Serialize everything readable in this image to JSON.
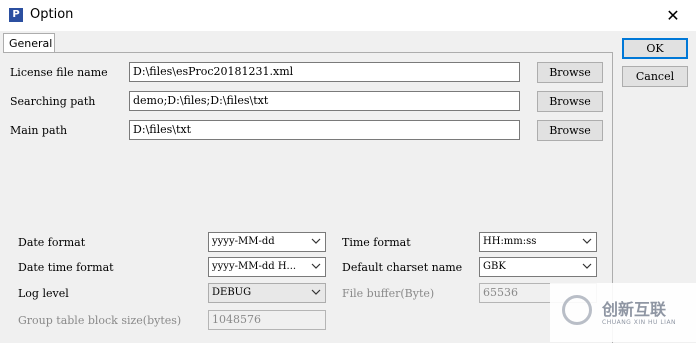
{
  "window": {
    "title": "Option",
    "close_glyph": "✕",
    "app_icon": "P"
  },
  "tabs": [
    {
      "label": "General"
    }
  ],
  "dialog_buttons": {
    "ok": "OK",
    "cancel": "Cancel"
  },
  "paths": {
    "license": {
      "label": "License file name",
      "value": "D:\\files\\esProc20181231.xml",
      "browse": "Browse"
    },
    "searching": {
      "label": "Searching path",
      "value": "demo;D:\\files;D:\\files\\txt",
      "browse": "Browse"
    },
    "main": {
      "label": "Main path",
      "value": "D:\\files\\txt",
      "browse": "Browse"
    }
  },
  "settings": {
    "date_format": {
      "label": "Date format",
      "value": "yyyy-MM-dd"
    },
    "date_time_format": {
      "label": "Date time format",
      "value": "yyyy-MM-dd H..."
    },
    "log_level": {
      "label": "Log level",
      "value": "DEBUG"
    },
    "group_table_block_size": {
      "label": "Group table block size(bytes)",
      "value": "1048576"
    },
    "time_format": {
      "label": "Time format",
      "value": "HH:mm:ss"
    },
    "default_charset": {
      "label": "Default charset name",
      "value": "GBK"
    },
    "file_buffer": {
      "label": "File buffer(Byte)",
      "value": "65536"
    }
  },
  "watermark": {
    "text": "创新互联",
    "sub": "CHUANG XIN HU LIAN"
  },
  "icons": {
    "close": "close-icon",
    "dropdown": "chevron-down-icon",
    "app": "app-icon"
  }
}
